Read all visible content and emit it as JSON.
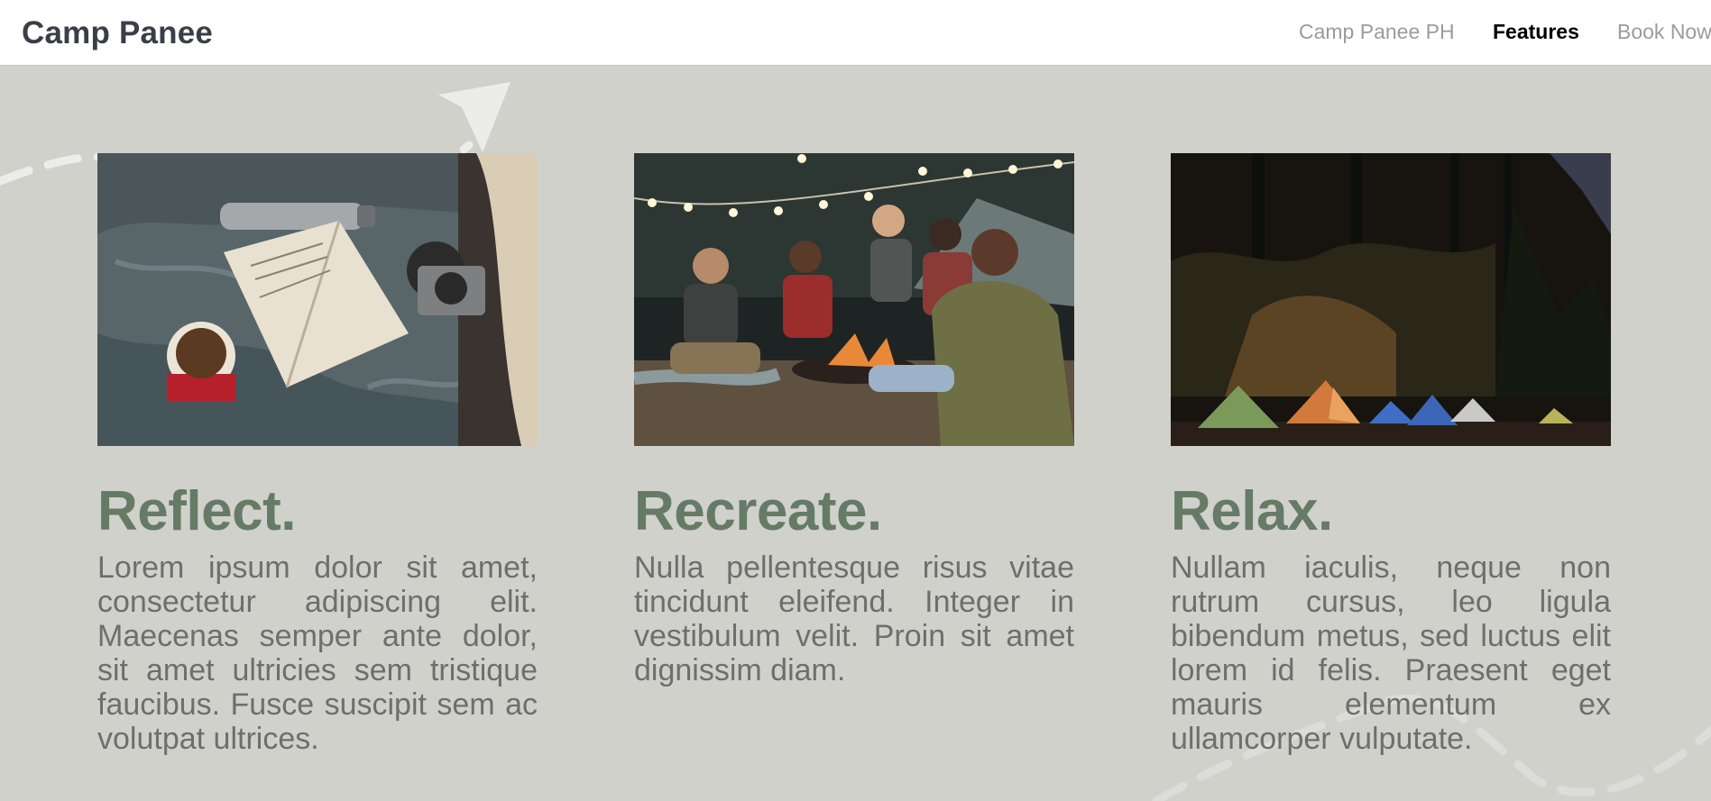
{
  "header": {
    "brand": "Camp Panee",
    "nav": [
      {
        "label": "Camp Panee PH",
        "active": false
      },
      {
        "label": "Features",
        "active": true
      },
      {
        "label": "Book Now",
        "active": false
      }
    ]
  },
  "features": [
    {
      "title": "Reflect.",
      "text": "Lorem ipsum dolor sit amet, consectetur adipiscing elit. Maecenas semper ante dolor, sit amet ultricies sem tristique faucibus. Fusce suscipit sem ac volutpat ultrices.",
      "image": "picnic-blanket-book-camera-mug-photo"
    },
    {
      "title": "Recreate.",
      "text": "Nulla pellentesque risus vitae tincidunt eleifend. Integer in vestibulum velit. Proin sit amet dignissim diam.",
      "image": "friends-roasting-marshmallows-campfire-photo"
    },
    {
      "title": "Relax.",
      "text": "Nullam iaculis, neque non rutrum cursus, leo ligula bibendum metus, sed luctus elit lorem id felis. Praesent eget mauris elementum ex ullamcorper vulputate.",
      "image": "tents-in-forest-night-photo"
    }
  ],
  "colors": {
    "background": "#d1d1cc",
    "header": "#ffffff",
    "accent_green": "#657b66",
    "body_text": "#6e6e6e",
    "nav_inactive": "#9b9b9b"
  }
}
